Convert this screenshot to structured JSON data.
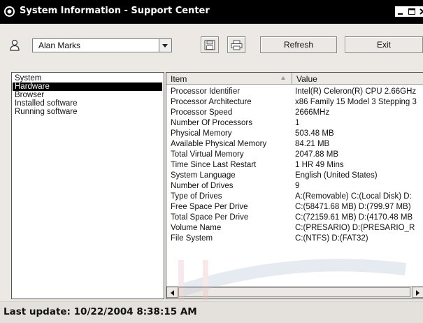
{
  "window": {
    "title": "System Information - Support Center",
    "controls": [
      "minimize-icon",
      "maximize-icon",
      "close-icon"
    ]
  },
  "toolbar": {
    "user": "Alan Marks",
    "save_icon": "floppy-disk-icon",
    "print_icon": "printer-icon",
    "refresh_label": "Refresh",
    "exit_label": "Exit"
  },
  "categories": {
    "selected": "Hardware",
    "items": [
      "System",
      "Hardware",
      "Browser",
      "Installed software",
      "Running software"
    ]
  },
  "table": {
    "columns": [
      "Item",
      "Value"
    ],
    "rows": [
      {
        "item": "Processor Identifier",
        "value": "Intel(R) Celeron(R) CPU 2.66GHz"
      },
      {
        "item": "Processor Architecture",
        "value": "x86 Family 15 Model 3 Stepping 3"
      },
      {
        "item": "Processor Speed",
        "value": "2666MHz"
      },
      {
        "item": "Number Of Processors",
        "value": "1"
      },
      {
        "item": "Physical Memory",
        "value": "503.48 MB"
      },
      {
        "item": "Available Physical Memory",
        "value": "84.21 MB"
      },
      {
        "item": "Total Virtual Memory",
        "value": "2047.88 MB"
      },
      {
        "item": "Time Since Last Restart",
        "value": "1 HR 49 Mins"
      },
      {
        "item": "System Language",
        "value": "English (United States)"
      },
      {
        "item": "Number of Drives",
        "value": "9"
      },
      {
        "item": "Type of Drives",
        "value": "A:(Removable)  C:(Local Disk)  D:"
      },
      {
        "item": "Free Space Per Drive",
        "value": "C:(58471.68 MB)  D:(799.97 MB)"
      },
      {
        "item": "Total Space Per Drive",
        "value": "C:(72159.61 MB)  D:(4170.48 MB"
      },
      {
        "item": "Volume Name",
        "value": "C:(PRESARIO)  D:(PRESARIO_R"
      },
      {
        "item": "File System",
        "value": "C:(NTFS)  D:(FAT32)"
      }
    ]
  },
  "status": {
    "text": "Last update: 10/22/2004 8:38:15 AM"
  },
  "colors": {
    "titlebar": "#000000",
    "selection": "#000000",
    "window_bg": "#ece9e4"
  }
}
